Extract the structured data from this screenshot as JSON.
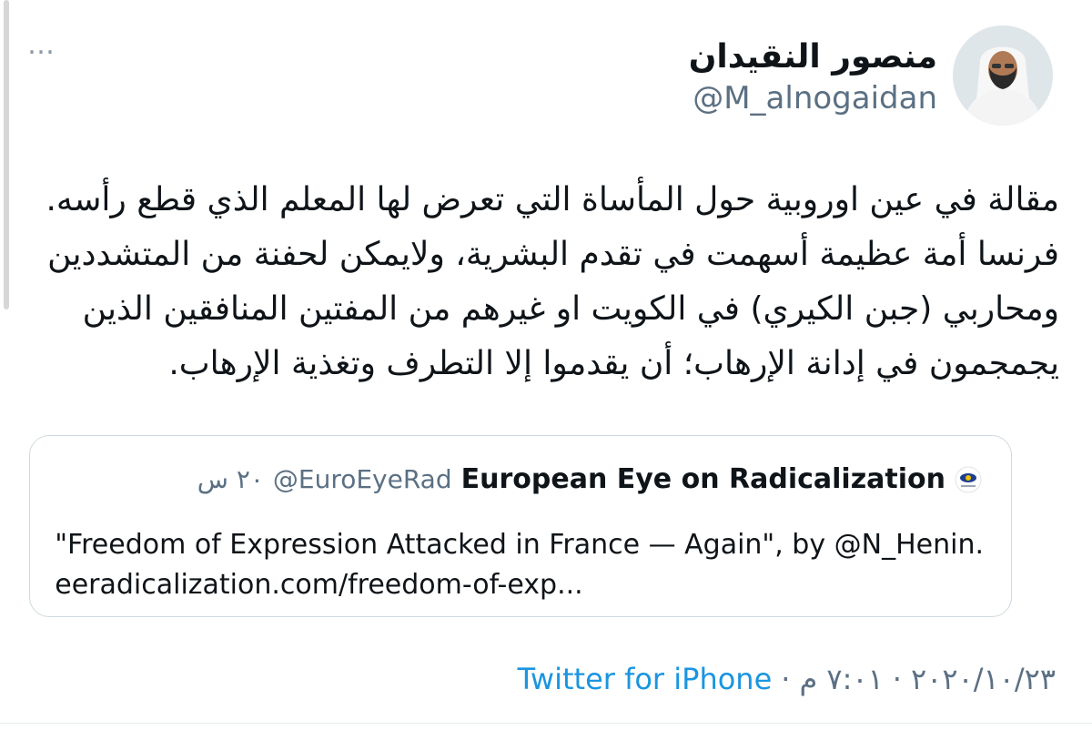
{
  "author": {
    "display_name": "منصور النقيدان",
    "handle": "@M_alnogaidan"
  },
  "more_menu_glyph": "…",
  "tweet": {
    "lines": [
      "مقالة في عين اوروبية حول المأساة التي تعرض لها المعلم الذي قطع رأسه.",
      "فرنسا أمة عظيمة أسهمت في تقدم البشرية،  ولايمكن لحفنة من المتشددين",
      "ومحاربي (جبن الكيري) في الكويت او غيرهم من المفتين المنافقين الذين",
      "يجمجمون في إدانة الإرهاب؛ أن يقدموا إلا التطرف وتغذية الإرهاب."
    ]
  },
  "quote": {
    "name": "European Eye on Radicalization",
    "handle": "@EuroEyeRad",
    "time": "٢٠ س",
    "text_line1": "\"Freedom of Expression Attacked in France — Again\", by @N_Henin.",
    "text_line2": "eeradicalization.com/freedom-of-exp..."
  },
  "meta": {
    "date": "٢٠٢٠/١٠/٢٣",
    "time": "٧:٠١ م",
    "source": "Twitter for iPhone"
  },
  "colors": {
    "link": "#1b95e0",
    "secondary_text": "#5b7083",
    "card_border": "#cfd9de"
  }
}
